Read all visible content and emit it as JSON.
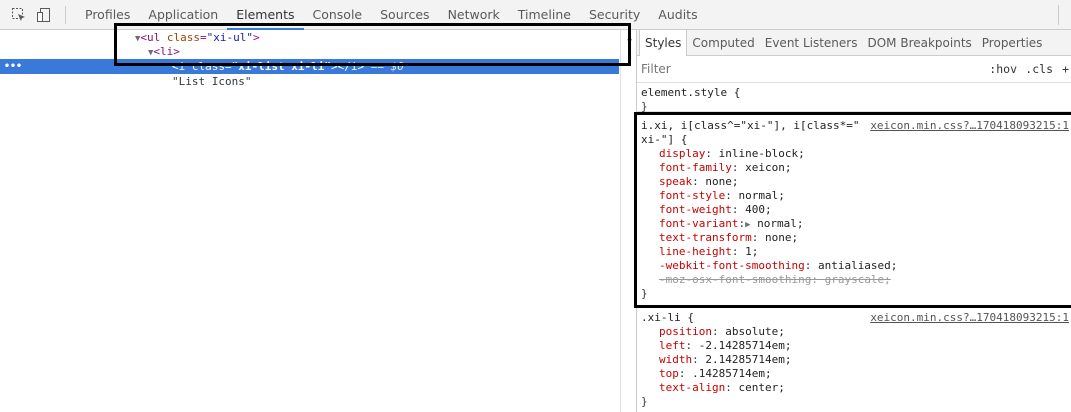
{
  "toolbar": {
    "tabs": [
      "Profiles",
      "Application",
      "Elements",
      "Console",
      "Sources",
      "Network",
      "Timeline",
      "Security",
      "Audits"
    ],
    "active_tab": "Elements"
  },
  "dom": {
    "line1": {
      "tag_open": "<ul ",
      "attr_name": "class",
      "eq": "=",
      "attr_value": "\"xi-ul\"",
      "tag_close": ">"
    },
    "line2": {
      "text": "<li>"
    },
    "line3": {
      "tag_open": "<i ",
      "attr_name": "class",
      "eq": "=",
      "attr_value": "\"xi-list xi-li\"",
      "tag_close": "></i>",
      "eq_sign": "== $0",
      "dots": "•••"
    },
    "line4": {
      "text": "\"List Icons\""
    }
  },
  "styles_pane": {
    "tabs": [
      "Styles",
      "Computed",
      "Event Listeners",
      "DOM Breakpoints",
      "Properties"
    ],
    "active_tab": "Styles",
    "filter_placeholder": "Filter",
    "hov": ":hov",
    "cls": ".cls",
    "plus": "+",
    "element_style": {
      "selector": "element.style {",
      "close": "}"
    },
    "rule_xi": {
      "selector_line1": "i.xi, i[class^=\"xi-\"], i[class*=\"",
      "selector_line2": "xi-\"] {",
      "source": "xeicon.min.css?…170418093215:1",
      "props": [
        {
          "name": "display",
          "value": "inline-block;"
        },
        {
          "name": "font-family",
          "value": "xeicon;"
        },
        {
          "name": "speak",
          "value": "none;"
        },
        {
          "name": "font-style",
          "value": "normal;"
        },
        {
          "name": "font-weight",
          "value": "400;"
        },
        {
          "name": "font-variant",
          "value": "normal;"
        },
        {
          "name": "text-transform",
          "value": "none;"
        },
        {
          "name": "line-height",
          "value": "1;"
        },
        {
          "name": "-webkit-font-smoothing",
          "value": "antialiased;"
        },
        {
          "name": "-moz-osx-font-smoothing",
          "value": "grayscale;"
        }
      ],
      "close": "}"
    },
    "rule_xi_li": {
      "selector": ".xi-li {",
      "source": "xeicon.min.css?…170418093215:1",
      "props": [
        {
          "name": "position",
          "value": "absolute;"
        },
        {
          "name": "left",
          "value": "-2.14285714em;"
        },
        {
          "name": "width",
          "value": "2.14285714em;"
        },
        {
          "name": "top",
          "value": ".14285714em;"
        },
        {
          "name": "text-align",
          "value": "center;"
        }
      ],
      "close": "}"
    }
  }
}
